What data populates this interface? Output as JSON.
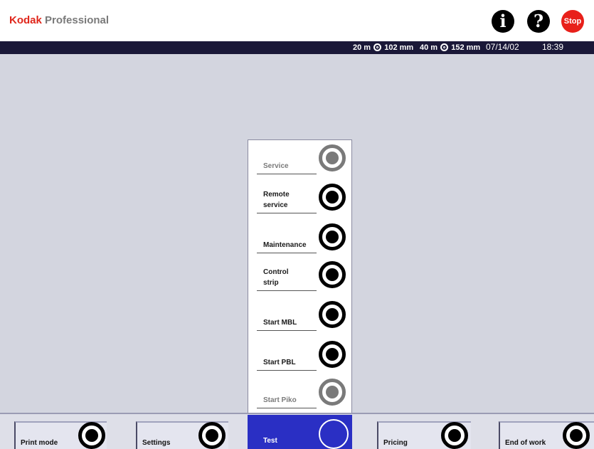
{
  "header": {
    "brand_primary": "Kodak",
    "brand_secondary": "Professional",
    "info_icon": "i",
    "help_icon": "?",
    "stop_label": "Stop"
  },
  "status": {
    "spool1_length": "20 m",
    "spool1_width": "102 mm",
    "spool2_length": "40 m",
    "spool2_width": "152 mm",
    "date": "07/14/02",
    "time": "18:39"
  },
  "menu": {
    "items": [
      {
        "label": "Service",
        "enabled": false
      },
      {
        "label": "Remote\nservice",
        "enabled": true
      },
      {
        "label": "Maintenance",
        "enabled": true
      },
      {
        "label": "Control\nstrip",
        "enabled": true
      },
      {
        "label": "Start MBL",
        "enabled": true
      },
      {
        "label": "Start PBL",
        "enabled": true
      },
      {
        "label": "Start Piko",
        "enabled": false
      }
    ]
  },
  "bottom": {
    "buttons": [
      {
        "label": "Print mode"
      },
      {
        "label": "Settings"
      },
      {
        "label": "Test",
        "active": true
      },
      {
        "label": "Pricing"
      },
      {
        "label": "End of work"
      }
    ]
  },
  "colors": {
    "brand_red": "#e0261b",
    "status_bar": "#1a1838",
    "active_tab": "#2a2fc4",
    "stop_red": "#e8201a"
  }
}
